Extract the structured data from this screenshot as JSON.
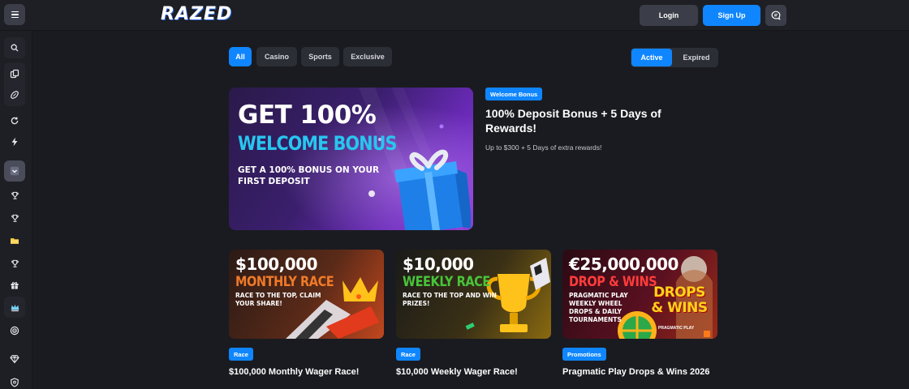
{
  "header": {
    "logo_text": "RAZED",
    "login_label": "Login",
    "signup_label": "Sign Up"
  },
  "colors": {
    "accent": "#0f86ff",
    "background": "#1a1b20",
    "chip": "#2c2e36",
    "hero_cyan": "#27c6f0",
    "race_orange": "#f07a28",
    "race_green": "#49c43a",
    "drops_red": "#ff3c3c"
  },
  "sidebar": {
    "icons": [
      "search-icon",
      "casino-chip-icon",
      "football-icon",
      "refresh-icon",
      "lightning-icon",
      "chevron-down-icon",
      "trophy-icon",
      "trophy-icon",
      "folder-icon",
      "trophy-icon",
      "gift-icon",
      "crown-icon",
      "target-icon",
      "diamond-icon",
      "shield-icon"
    ]
  },
  "filters": {
    "categories": [
      {
        "label": "All",
        "active": true
      },
      {
        "label": "Casino",
        "active": false
      },
      {
        "label": "Sports",
        "active": false
      },
      {
        "label": "Exclusive",
        "active": false
      }
    ],
    "status": [
      {
        "label": "Active",
        "active": true
      },
      {
        "label": "Expired",
        "active": false
      }
    ]
  },
  "hero": {
    "image_line1": "GET 100%",
    "image_line2": "WELCOME BONUS",
    "image_line3": "GET A 100% BONUS ON YOUR FIRST DEPOSIT",
    "badge": "Welcome Bonus",
    "title": "100% Deposit Bonus + 5 Days of Rewards!",
    "subtitle": "Up to $300 + 5 Days of extra rewards!"
  },
  "cards": [
    {
      "image_amount": "$100,000",
      "image_headline": "MONTHLY RACE",
      "image_desc": "RACE TO THE TOP, CLAIM YOUR SHARE!",
      "badge": "Race",
      "title": "$100,000 Monthly Wager Race!"
    },
    {
      "image_amount": "$10,000",
      "image_headline": "WEEKLY RACE",
      "image_desc": "RACE TO THE TOP AND WIN PRIZES!",
      "badge": "Race",
      "title": "$10,000 Weekly Wager Race!"
    },
    {
      "image_amount": "€25,000,000",
      "image_headline": "DROP & WINS",
      "image_desc": "PRAGMATIC PLAY WEEKLY WHEEL DROPS & DAILY TOURNAMENTS",
      "image_logo": "DROPS & WINS",
      "image_brand": "PRAGMATIC PLAY",
      "badge": "Promotions",
      "title": "Pragmatic Play Drops & Wins 2026"
    }
  ]
}
